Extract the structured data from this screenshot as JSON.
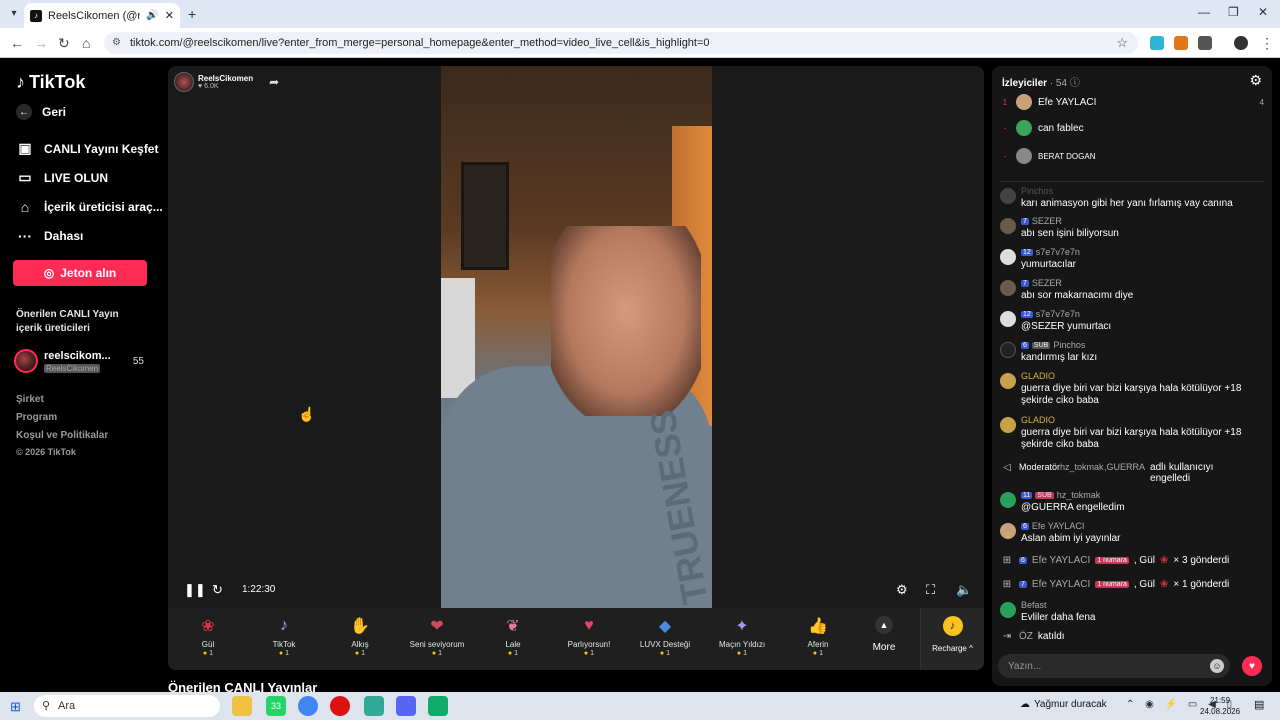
{
  "browser": {
    "tab_title": "ReelsCikomen (@reelscikom",
    "url": "tiktok.com/@reelscikomen/live?enter_from_merge=personal_homepage&enter_method=video_live_cell&is_highlight=0"
  },
  "sidebar": {
    "logo": "TikTok",
    "back": "Geri",
    "items": [
      {
        "label": "CANLI Yayını Keşfet",
        "icon": "live-explore-icon"
      },
      {
        "label": "LIVE OLUN",
        "icon": "camera-icon"
      },
      {
        "label": "İçerik üreticisi araç...",
        "icon": "creator-tools-icon"
      },
      {
        "label": "Dahası",
        "icon": "more-dots-icon"
      }
    ],
    "jeton_button": "Jeton alın",
    "suggested_title": "Önerilen CANLI Yayın içerik üreticileri",
    "creator": {
      "name": "reelscikom...",
      "handle": "ReelsCikomen",
      "count": "55"
    },
    "footer": [
      "Şirket",
      "Program",
      "Koşul ve Politikalar",
      "© 2026 TikTok"
    ]
  },
  "player": {
    "host_name": "ReelsCikomen",
    "host_likes": "6.0K",
    "elapsed": "1:22:30",
    "shirt_text": "TRUENESS",
    "gifts": [
      {
        "name": "Gül",
        "price": "1",
        "icon": "rose-icon",
        "color": "#d9324b"
      },
      {
        "name": "TikTok",
        "price": "1",
        "icon": "tiktok-gift-icon",
        "color": "#6d5ad8"
      },
      {
        "name": "Alkış",
        "price": "1",
        "icon": "clapping-icon",
        "color": "#e4a43a"
      },
      {
        "name": "Seni seviyorum",
        "price": "1",
        "icon": "love-icon",
        "color": "#d14b5e"
      },
      {
        "name": "Lale",
        "price": "1",
        "icon": "tulip-icon",
        "color": "#e07ca6"
      },
      {
        "name": "Parlıyorsun!",
        "price": "1",
        "icon": "sparkle-heart-icon",
        "color": "#e4456e"
      },
      {
        "name": "LUVX Desteği",
        "price": "1",
        "icon": "luvx-icon",
        "color": "#4a8bdc"
      },
      {
        "name": "Maçın Yıldızı",
        "price": "1",
        "icon": "star-icon",
        "color": "#7e6ae0"
      },
      {
        "name": "Aferin",
        "price": "1",
        "icon": "thumbs-up-icon",
        "color": "#e8b34a"
      }
    ],
    "more_label": "More",
    "recharge_label": "Recharge ^",
    "below_title": "Önerilen CANLI Yayınlar"
  },
  "chat": {
    "viewers_title": "İzleyiciler",
    "viewers_count": "· 54",
    "viewers": [
      {
        "rank": "1",
        "name": "Efe YAYLACI",
        "count": "4",
        "color": "#c9a27a"
      },
      {
        "rank": "-",
        "name": "can fablec",
        "count": "",
        "color": "#3aa45a"
      },
      {
        "rank": "-",
        "name": "BERAT DOGAN",
        "count": "",
        "color": "#888"
      }
    ],
    "partial_header": "Pinchos",
    "messages": [
      {
        "name": "",
        "level": "",
        "sub": false,
        "text": "karı animasyon gibi her yanı fırlamış vay canına",
        "color": "#444"
      },
      {
        "name": "SEZER",
        "level": "7",
        "sub": false,
        "text": "abı sen işini biliyorsun",
        "color": "#6a5a4a"
      },
      {
        "name": "s7e7v7e7n",
        "level": "12",
        "sub": false,
        "text": "yumurtacılar",
        "color": "#ddd"
      },
      {
        "name": "SEZER",
        "level": "7",
        "sub": false,
        "text": "abı sor makarnacımı diye",
        "color": "#6a5a4a"
      },
      {
        "name": "s7e7v7e7n",
        "level": "12",
        "sub": false,
        "text": "@SEZER yumurtacı",
        "color": "#ddd"
      },
      {
        "name": "Pinchos",
        "level": "6",
        "sub": true,
        "text": "kandırmış lar kızı",
        "color": "#222"
      },
      {
        "name": "GLADIO",
        "level": "",
        "sub": false,
        "text": "guerra diye biri var bizi karşıya hala kötülüyor +18 şekirde ciko baba",
        "color": "#c8a24a"
      },
      {
        "name": "GLADIO",
        "level": "",
        "sub": false,
        "text": "guerra diye biri var bizi karşıya hala kötülüyor +18 şekirde ciko baba",
        "color": "#c8a24a"
      }
    ],
    "moderation": {
      "prefix": "Moderatör",
      "actor": "hz_tokmak",
      "target": ",GUERRA",
      "suffix": "adlı kullanıcıyı engelledi"
    },
    "messages2": [
      {
        "name": "hz_tokmak",
        "level": "11",
        "sub": true,
        "text": "@GUERRA engelledim",
        "color": "#2aa05a"
      },
      {
        "name": "Efe YAYLACI",
        "level": "6",
        "sub": false,
        "text": "Aslan abim iyi yayınlar",
        "color": "#c9a27a"
      }
    ],
    "gift_events": [
      {
        "name": "Efe YAYLACI",
        "level": "6",
        "badge": "1 numara",
        "text": ", Gül",
        "count": "× 3 gönderdi"
      },
      {
        "name": "Efe YAYLACI",
        "level": "7",
        "badge": "1 numara",
        "text": ", Gül",
        "count": "× 1 gönderdi"
      }
    ],
    "last_message": {
      "name": "Befast",
      "text": "Evliler daha fena",
      "color": "#2aa05a"
    },
    "join": {
      "name": "ÖZ",
      "text": "katıldı"
    },
    "input_placeholder": "Yazın..."
  },
  "taskbar": {
    "search": "Ara",
    "weather": "Yağmur duracak",
    "time": "21:59",
    "date": "24.08.2026",
    "badge": "33"
  }
}
